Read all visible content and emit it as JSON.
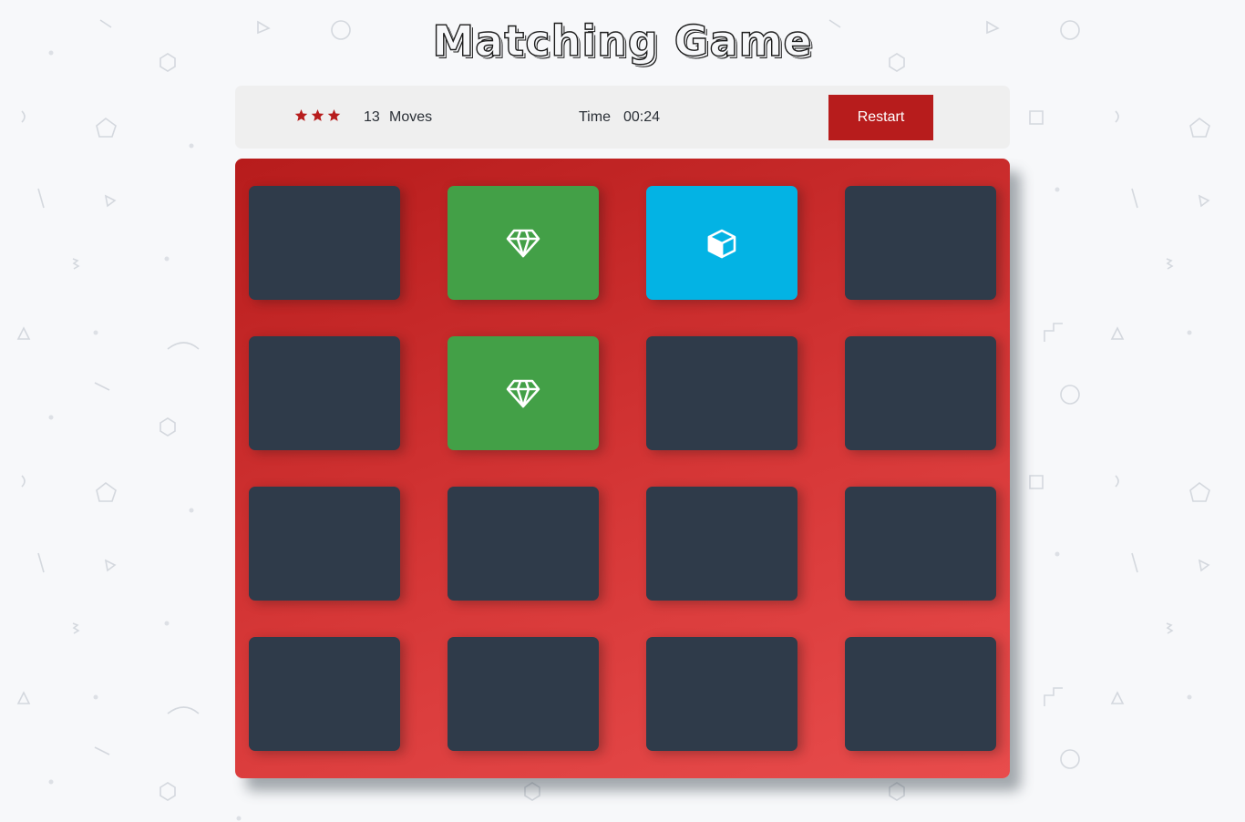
{
  "title": "Matching Game",
  "score_panel": {
    "stars": [
      "star-icon",
      "star-icon",
      "star-icon"
    ],
    "star_rating": 3,
    "moves_count": "13",
    "moves_label": "Moves",
    "time_label": "Time",
    "time_value": "00:24",
    "restart_label": "Restart"
  },
  "deck": {
    "rows": 4,
    "cols": 4,
    "cards": [
      {
        "state": "closed",
        "icon": ""
      },
      {
        "state": "match",
        "icon": "diamond-icon"
      },
      {
        "state": "open",
        "icon": "cube-icon"
      },
      {
        "state": "closed",
        "icon": ""
      },
      {
        "state": "closed",
        "icon": ""
      },
      {
        "state": "match",
        "icon": "diamond-icon"
      },
      {
        "state": "closed",
        "icon": ""
      },
      {
        "state": "closed",
        "icon": ""
      },
      {
        "state": "closed",
        "icon": ""
      },
      {
        "state": "closed",
        "icon": ""
      },
      {
        "state": "closed",
        "icon": ""
      },
      {
        "state": "closed",
        "icon": ""
      },
      {
        "state": "closed",
        "icon": ""
      },
      {
        "state": "closed",
        "icon": ""
      },
      {
        "state": "closed",
        "icon": ""
      },
      {
        "state": "closed",
        "icon": ""
      }
    ]
  },
  "colors": {
    "background": "#f7f8fa",
    "deck_gradient_start": "#b71c1c",
    "deck_gradient_end": "#e84c4c",
    "card_closed": "#2f3b4a",
    "card_match": "#43a047",
    "card_open": "#03b3e4",
    "restart_button": "#b71c1c",
    "star": "#b71c1c",
    "score_panel": "#efefef"
  }
}
